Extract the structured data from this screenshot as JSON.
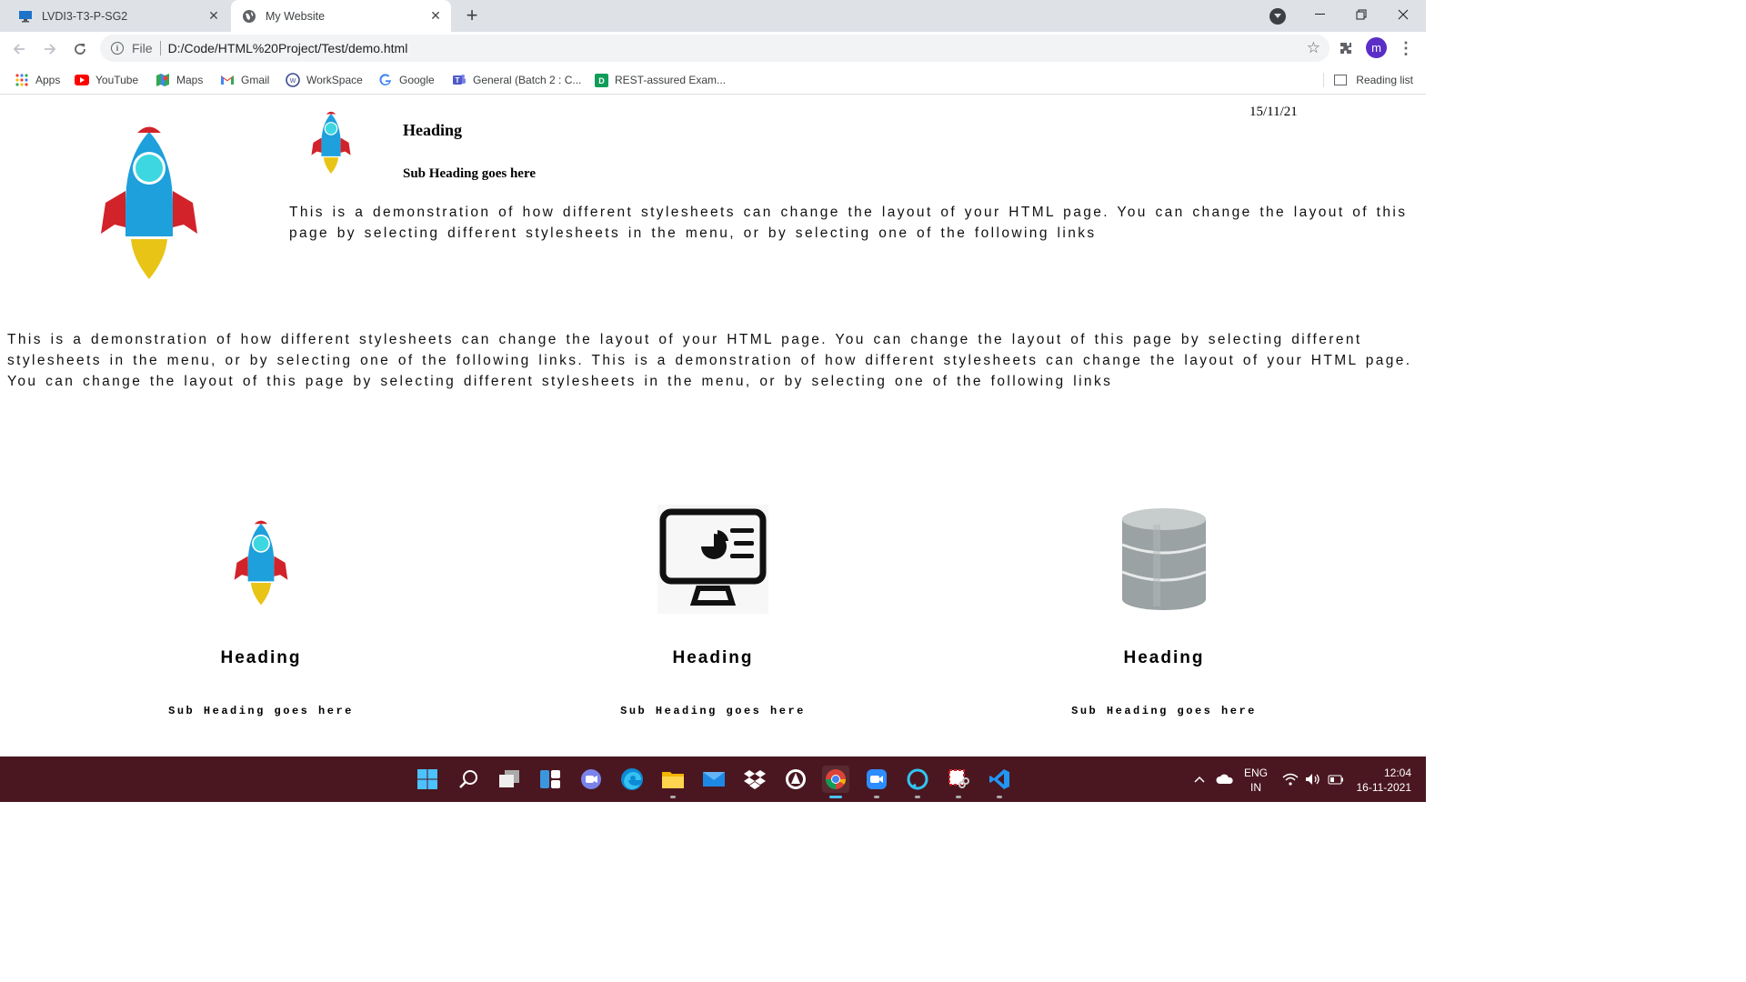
{
  "browser": {
    "tabs": [
      {
        "title": "LVDI3-T3-P-SG2",
        "icon": "remote-desktop-icon"
      },
      {
        "title": "My Website",
        "icon": "globe-icon"
      }
    ],
    "address": {
      "scheme": "File",
      "url": "D:/Code/HTML%20Project/Test/demo.html"
    },
    "avatar_letter": "m",
    "bookmarks": [
      {
        "label": "Apps",
        "icon": "apps-grid-icon"
      },
      {
        "label": "YouTube",
        "icon": "youtube-icon"
      },
      {
        "label": "Maps",
        "icon": "maps-icon"
      },
      {
        "label": "Gmail",
        "icon": "gmail-icon"
      },
      {
        "label": "WorkSpace",
        "icon": "workspace-icon"
      },
      {
        "label": "Google",
        "icon": "google-icon"
      },
      {
        "label": "General (Batch 2 : C...",
        "icon": "teams-icon"
      },
      {
        "label": "REST-assured Exam...",
        "icon": "doc-d-icon"
      }
    ],
    "reading_list": "Reading list"
  },
  "page": {
    "heading": "Heading",
    "subheading": "Sub Heading goes here",
    "date": "15/11/21",
    "paragraph1": "This is a demonstration of how different stylesheets can change the layout of your HTML page. You can change the layout of this page by selecting different stylesheets in the menu, or by selecting one of the following links",
    "paragraph2": "This is a demonstration of how different stylesheets can change the layout of your HTML page. You can change the layout of this page by selecting different stylesheets in the menu, or by selecting one of the following links. This is a demonstration of how different stylesheets can change the layout of your HTML page. You can change the layout of this page by selecting different stylesheets in the menu, or by selecting one of the following links",
    "cards": [
      {
        "icon": "rocket-icon",
        "heading": "Heading",
        "subheading": "Sub Heading goes here"
      },
      {
        "icon": "monitor-chart-icon",
        "heading": "Heading",
        "subheading": "Sub Heading goes here"
      },
      {
        "icon": "database-icon",
        "heading": "Heading",
        "subheading": "Sub Heading goes here"
      }
    ]
  },
  "taskbar": {
    "apps": [
      "start-icon",
      "search-icon",
      "task-view-icon",
      "widgets-icon",
      "chat-icon",
      "edge-icon",
      "file-explorer-icon",
      "mail-icon",
      "dropbox-icon",
      "app-icon",
      "chrome-icon",
      "zoom-icon",
      "alexa-icon",
      "snipping-tool-icon",
      "vscode-icon"
    ],
    "language": {
      "top": "ENG",
      "bottom": "IN"
    },
    "time": "12:04",
    "date": "16-11-2021"
  },
  "colors": {
    "rocket_body": "#1ea0dc",
    "rocket_fins": "#d2232a",
    "rocket_flame": "#e8c417",
    "taskbar": "#4a1720"
  }
}
